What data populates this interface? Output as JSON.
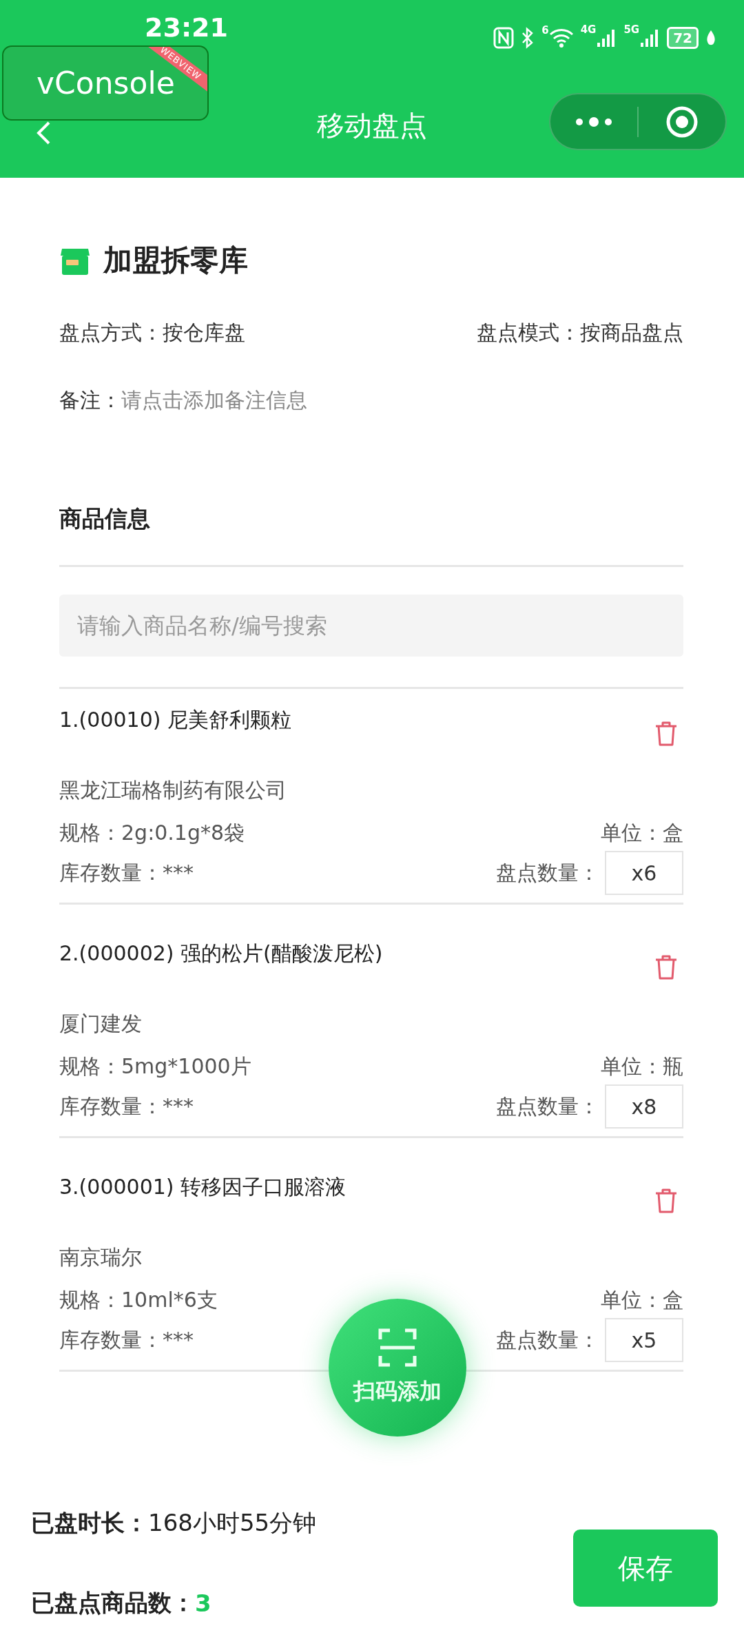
{
  "status_bar": {
    "time": "23:21",
    "wifi_label": "6",
    "network_labels": [
      "4G",
      "5G"
    ],
    "battery": "72"
  },
  "debug_button": {
    "label": "vConsole",
    "ribbon": "WEBVIEW"
  },
  "nav": {
    "title": "移动盘点"
  },
  "warehouse": {
    "name": "加盟拆零库",
    "method_label": "盘点方式：",
    "method": "按仓库盘",
    "mode_label": "盘点模式：",
    "mode": "按商品盘点",
    "remark_label": "备注：",
    "remark_placeholder": "请点击添加备注信息"
  },
  "goods": {
    "title": "商品信息",
    "search_placeholder": "请输入商品名称/编号搜索",
    "items": [
      {
        "title": "1.(00010) 尼美舒利颗粒",
        "maker": "黑龙江瑞格制药有限公司",
        "spec_label": "规格：",
        "spec": "2g:0.1g*8袋",
        "unit_label": "单位：",
        "unit": "盒",
        "stock_label": "库存数量：",
        "stock": "***",
        "count_label": "盘点数量：",
        "count": "x6"
      },
      {
        "title": "2.(000002) 强的松片(醋酸泼尼松)",
        "maker": "厦门建发",
        "spec_label": "规格：",
        "spec": "5mg*1000片",
        "unit_label": "单位：",
        "unit": "瓶",
        "stock_label": "库存数量：",
        "stock": "***",
        "count_label": "盘点数量：",
        "count": "x8"
      },
      {
        "title": "3.(000001) 转移因子口服溶液",
        "maker": "南京瑞尔",
        "spec_label": "规格：",
        "spec": "10ml*6支",
        "unit_label": "单位：",
        "unit": "盒",
        "stock_label": "库存数量：",
        "stock": "***",
        "count_label": "盘点数量：",
        "count": "x5"
      }
    ]
  },
  "scan_button": {
    "label": "扫码添加"
  },
  "summary": {
    "duration_label": "已盘时长：",
    "duration": "168小时55分钟",
    "count_label": "已盘点商品数：",
    "count": "3"
  },
  "save_button": {
    "label": "保存"
  }
}
